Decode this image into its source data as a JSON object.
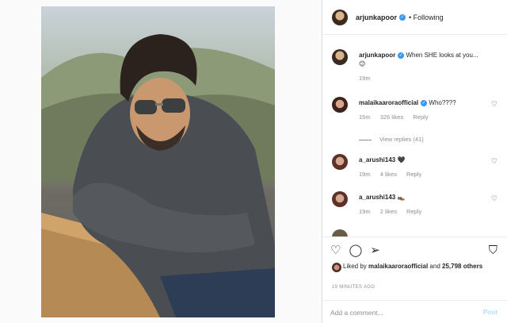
{
  "post": {
    "author": "arjunkapoor",
    "follow_status": "• Following",
    "caption": "When SHE looks at you... 😉",
    "caption_time": "19m",
    "liked_by_text": "Liked by",
    "liked_by_user": "malaikaaroraofficial",
    "liked_by_and": "and",
    "likes_others": "25,798 others",
    "timestamp": "19 MINUTES AGO"
  },
  "comments": [
    {
      "user": "malaikaaroraofficial",
      "verified": true,
      "text": "Who????",
      "time": "15m",
      "likes": "326 likes",
      "reply": "Reply"
    },
    {
      "user": "a_arushi143",
      "verified": false,
      "text": "🖤",
      "time": "19m",
      "likes": "4 likes",
      "reply": "Reply"
    },
    {
      "user": "a_arushi143",
      "verified": false,
      "text": "👞",
      "time": "19m",
      "likes": "2 likes",
      "reply": "Reply"
    }
  ],
  "view_replies": "View replies (41)",
  "add_comment": {
    "placeholder": "Add a comment...",
    "post_label": "Post"
  },
  "icons": {
    "heart": "heart-icon",
    "comment": "comment-icon",
    "share": "share-icon",
    "bookmark": "bookmark-icon"
  },
  "colors": {
    "verified": "#3897f0",
    "post_disabled": "#b2dffc"
  }
}
